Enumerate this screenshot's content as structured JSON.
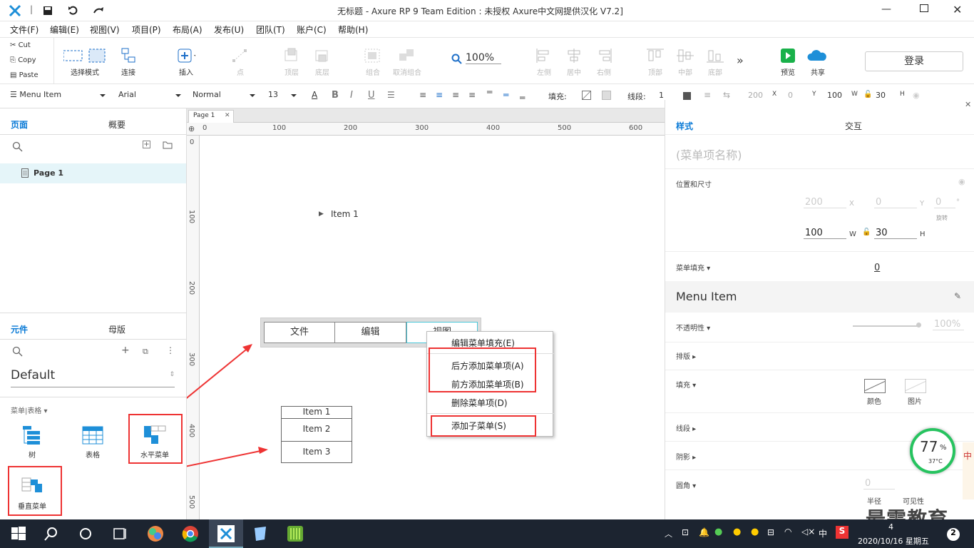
{
  "titlebar": {
    "title": "无标题 - Axure RP 9 Team Edition : 未授权    Axure中文网提供汉化 V7.2]"
  },
  "menubar": {
    "items": [
      "文件(F)",
      "编辑(E)",
      "视图(V)",
      "项目(P)",
      "布局(A)",
      "发布(U)",
      "团队(T)",
      "账户(C)",
      "帮助(H)"
    ]
  },
  "clipboard": {
    "cut": "Cut",
    "copy": "Copy",
    "paste": "Paste"
  },
  "toolbar": {
    "select_mode": "选择模式",
    "connect": "连接",
    "insert": "插入",
    "point": "点",
    "top_layer": "顶层",
    "bottom_layer": "底层",
    "group": "组合",
    "ungroup": "取消组合",
    "zoom": "100%",
    "left": "左侧",
    "center": "居中",
    "right": "右侧",
    "top": "顶部",
    "middle": "中部",
    "bottom": "底部",
    "preview": "预览",
    "share": "共享",
    "login": "登录"
  },
  "format": {
    "style": "Menu Item",
    "font": "Arial",
    "weight": "Normal",
    "size": "13",
    "fill_label": "填充:",
    "stroke_label": "线段:",
    "stroke_val": "1",
    "x_val": "200",
    "x": "X",
    "x2": "0",
    "y": "Y",
    "w_val": "100",
    "w": "W",
    "h_val": "30",
    "h": "H"
  },
  "leftpanel": {
    "tab_pages": "页面",
    "tab_outline": "概要",
    "page1": "Page 1",
    "tab_widgets": "元件",
    "tab_masters": "母版",
    "library": "Default",
    "category": "菜单|表格",
    "widgets": [
      "树",
      "表格",
      "水平菜单",
      "垂直菜单"
    ]
  },
  "canvas": {
    "tab": "Page 1",
    "ruler_h": [
      "0",
      "100",
      "200",
      "300",
      "400",
      "500",
      "600"
    ],
    "ruler_v": [
      "0",
      "100",
      "200",
      "300",
      "400",
      "500"
    ],
    "tree_item": "Item 1",
    "hmenu": [
      "文件",
      "编辑",
      "视图"
    ],
    "vmenu": [
      "Item 1",
      "Item 2",
      "Item 3"
    ],
    "context_menu": [
      "编辑菜单填充(E)",
      "后方添加菜单项(A)",
      "前方添加菜单项(B)",
      "删除菜单项(D)",
      "添加子菜单(S)"
    ]
  },
  "rightpanel": {
    "tab_style": "样式",
    "tab_interaction": "交互",
    "name_placeholder": "(菜单项名称)",
    "pos_size": "位置和尺寸",
    "x": "200",
    "x_lab": "X",
    "y": "0",
    "y_lab": "Y",
    "rot": "0",
    "rot_lab": "旋转",
    "deg": "°",
    "w": "100",
    "w_lab": "W",
    "h": "30",
    "h_lab": "H",
    "menu_fill": "菜单填充",
    "menu_fill_val": "0",
    "style_name": "Menu Item",
    "opacity": "不透明性",
    "opacity_val": "100%",
    "typeset": "排版",
    "fill": "填充",
    "fill_color": "颜色",
    "fill_image": "图片",
    "stroke": "线段",
    "shadow": "阴影",
    "radius": "圆角",
    "radius_val": "0",
    "half": "半径",
    "visible": "可见性"
  },
  "overlay": {
    "cpu": "77",
    "pct": "%",
    "temp": "37°C",
    "watermark": "最需教育",
    "ime": "中"
  },
  "taskbar": {
    "time": "4",
    "date": "2020/10/16 星期五",
    "lang": "中",
    "notif": "2"
  }
}
